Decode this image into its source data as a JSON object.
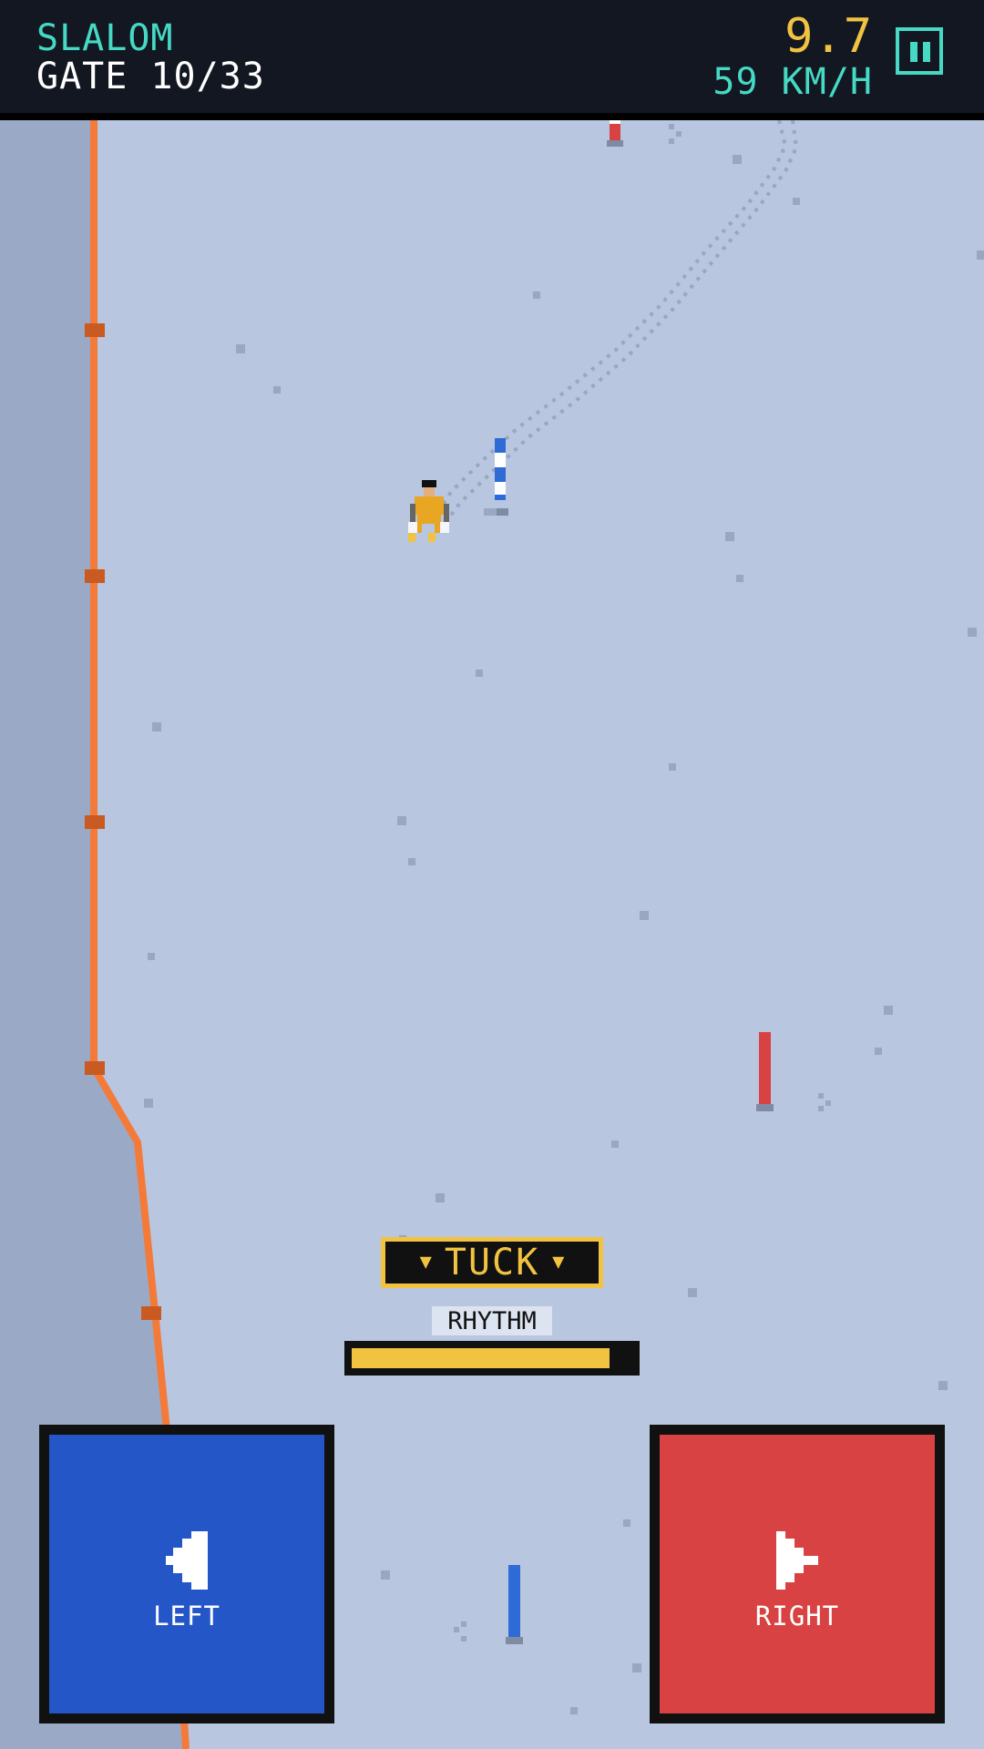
{
  "hud": {
    "mode": "SLALOM",
    "gate": "GATE 10/33",
    "time": "9.7",
    "speed": "59 KM/H"
  },
  "pause_icon": "pause-icon",
  "status": {
    "tuck": "TUCK",
    "rhythm_label": "RHYTHM",
    "rhythm_level": 0.92
  },
  "controls": {
    "left_label": "LEFT",
    "right_label": "RIGHT",
    "left_color": "#2456c8",
    "right_color": "#d94242"
  },
  "colors": {
    "snow": "#b8c6e0",
    "boundary": "#f47a3a",
    "accent_yellow": "#f2c241",
    "accent_teal": "#46d9c3",
    "gate_blue": "#2f6bd6",
    "gate_red": "#d94242"
  }
}
